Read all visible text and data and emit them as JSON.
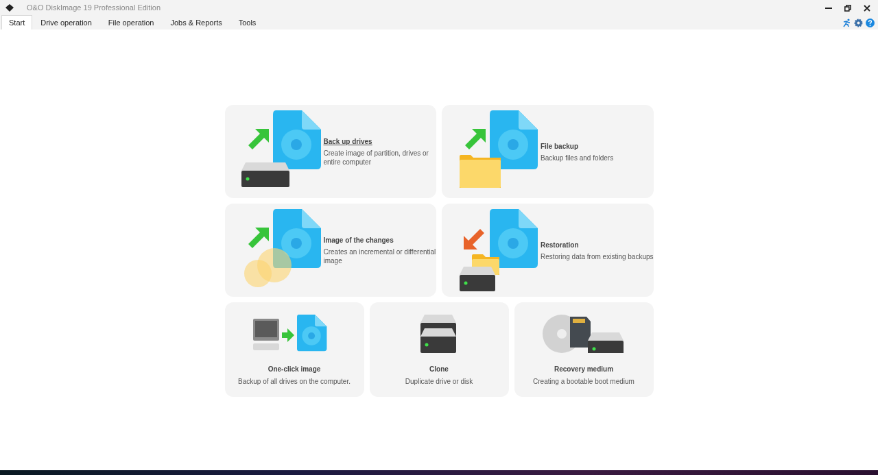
{
  "window": {
    "title": "O&O DiskImage 19 Professional Edition"
  },
  "tabs": [
    {
      "label": "Start",
      "selected": true
    },
    {
      "label": "Drive operation",
      "selected": false
    },
    {
      "label": "File operation",
      "selected": false
    },
    {
      "label": "Jobs & Reports",
      "selected": false
    },
    {
      "label": "Tools",
      "selected": false
    }
  ],
  "wide_cards": [
    {
      "kind": "drive-backup",
      "title": "Back up drives",
      "description": "Create image of partition, drives or entire computer",
      "underlined": true
    },
    {
      "kind": "file-backup",
      "title": "File backup",
      "description": "Backup files and folders",
      "underlined": false
    },
    {
      "kind": "changes",
      "title": "Image of the changes",
      "description": "Creates an incremental or differential image",
      "underlined": false
    },
    {
      "kind": "restore",
      "title": "Restoration",
      "description": "Restoring data from existing backups",
      "underlined": false
    }
  ],
  "small_cards": [
    {
      "kind": "one-click",
      "title": "One-click image",
      "description": "Backup of all drives on the computer."
    },
    {
      "kind": "clone",
      "title": "Clone",
      "description": "Duplicate drive or disk"
    },
    {
      "kind": "recovery",
      "title": "Recovery medium",
      "description": "Creating a bootable boot medium"
    }
  ]
}
